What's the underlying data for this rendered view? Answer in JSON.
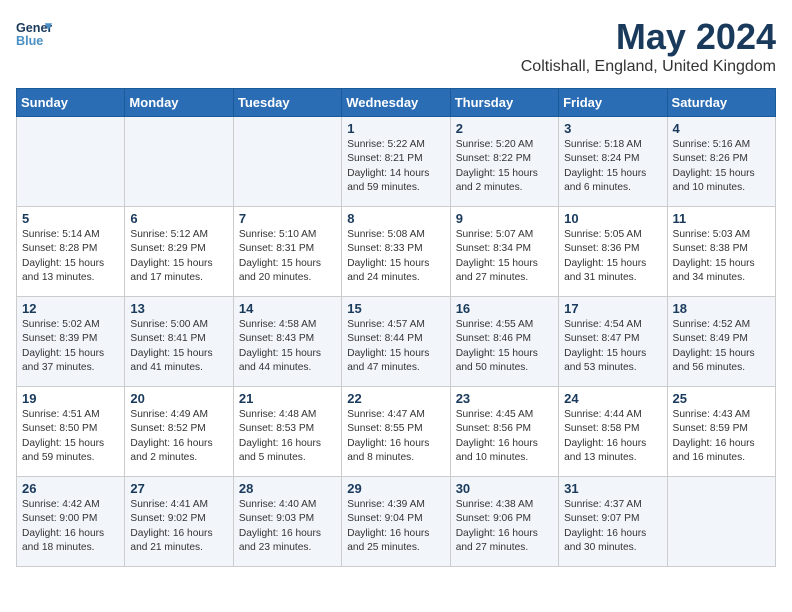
{
  "header": {
    "logo_line1": "General",
    "logo_line2": "Blue",
    "title": "May 2024",
    "subtitle": "Coltishall, England, United Kingdom"
  },
  "weekdays": [
    "Sunday",
    "Monday",
    "Tuesday",
    "Wednesday",
    "Thursday",
    "Friday",
    "Saturday"
  ],
  "weeks": [
    [
      {
        "day": "",
        "text": ""
      },
      {
        "day": "",
        "text": ""
      },
      {
        "day": "",
        "text": ""
      },
      {
        "day": "1",
        "text": "Sunrise: 5:22 AM\nSunset: 8:21 PM\nDaylight: 14 hours\nand 59 minutes."
      },
      {
        "day": "2",
        "text": "Sunrise: 5:20 AM\nSunset: 8:22 PM\nDaylight: 15 hours\nand 2 minutes."
      },
      {
        "day": "3",
        "text": "Sunrise: 5:18 AM\nSunset: 8:24 PM\nDaylight: 15 hours\nand 6 minutes."
      },
      {
        "day": "4",
        "text": "Sunrise: 5:16 AM\nSunset: 8:26 PM\nDaylight: 15 hours\nand 10 minutes."
      }
    ],
    [
      {
        "day": "5",
        "text": "Sunrise: 5:14 AM\nSunset: 8:28 PM\nDaylight: 15 hours\nand 13 minutes."
      },
      {
        "day": "6",
        "text": "Sunrise: 5:12 AM\nSunset: 8:29 PM\nDaylight: 15 hours\nand 17 minutes."
      },
      {
        "day": "7",
        "text": "Sunrise: 5:10 AM\nSunset: 8:31 PM\nDaylight: 15 hours\nand 20 minutes."
      },
      {
        "day": "8",
        "text": "Sunrise: 5:08 AM\nSunset: 8:33 PM\nDaylight: 15 hours\nand 24 minutes."
      },
      {
        "day": "9",
        "text": "Sunrise: 5:07 AM\nSunset: 8:34 PM\nDaylight: 15 hours\nand 27 minutes."
      },
      {
        "day": "10",
        "text": "Sunrise: 5:05 AM\nSunset: 8:36 PM\nDaylight: 15 hours\nand 31 minutes."
      },
      {
        "day": "11",
        "text": "Sunrise: 5:03 AM\nSunset: 8:38 PM\nDaylight: 15 hours\nand 34 minutes."
      }
    ],
    [
      {
        "day": "12",
        "text": "Sunrise: 5:02 AM\nSunset: 8:39 PM\nDaylight: 15 hours\nand 37 minutes."
      },
      {
        "day": "13",
        "text": "Sunrise: 5:00 AM\nSunset: 8:41 PM\nDaylight: 15 hours\nand 41 minutes."
      },
      {
        "day": "14",
        "text": "Sunrise: 4:58 AM\nSunset: 8:43 PM\nDaylight: 15 hours\nand 44 minutes."
      },
      {
        "day": "15",
        "text": "Sunrise: 4:57 AM\nSunset: 8:44 PM\nDaylight: 15 hours\nand 47 minutes."
      },
      {
        "day": "16",
        "text": "Sunrise: 4:55 AM\nSunset: 8:46 PM\nDaylight: 15 hours\nand 50 minutes."
      },
      {
        "day": "17",
        "text": "Sunrise: 4:54 AM\nSunset: 8:47 PM\nDaylight: 15 hours\nand 53 minutes."
      },
      {
        "day": "18",
        "text": "Sunrise: 4:52 AM\nSunset: 8:49 PM\nDaylight: 15 hours\nand 56 minutes."
      }
    ],
    [
      {
        "day": "19",
        "text": "Sunrise: 4:51 AM\nSunset: 8:50 PM\nDaylight: 15 hours\nand 59 minutes."
      },
      {
        "day": "20",
        "text": "Sunrise: 4:49 AM\nSunset: 8:52 PM\nDaylight: 16 hours\nand 2 minutes."
      },
      {
        "day": "21",
        "text": "Sunrise: 4:48 AM\nSunset: 8:53 PM\nDaylight: 16 hours\nand 5 minutes."
      },
      {
        "day": "22",
        "text": "Sunrise: 4:47 AM\nSunset: 8:55 PM\nDaylight: 16 hours\nand 8 minutes."
      },
      {
        "day": "23",
        "text": "Sunrise: 4:45 AM\nSunset: 8:56 PM\nDaylight: 16 hours\nand 10 minutes."
      },
      {
        "day": "24",
        "text": "Sunrise: 4:44 AM\nSunset: 8:58 PM\nDaylight: 16 hours\nand 13 minutes."
      },
      {
        "day": "25",
        "text": "Sunrise: 4:43 AM\nSunset: 8:59 PM\nDaylight: 16 hours\nand 16 minutes."
      }
    ],
    [
      {
        "day": "26",
        "text": "Sunrise: 4:42 AM\nSunset: 9:00 PM\nDaylight: 16 hours\nand 18 minutes."
      },
      {
        "day": "27",
        "text": "Sunrise: 4:41 AM\nSunset: 9:02 PM\nDaylight: 16 hours\nand 21 minutes."
      },
      {
        "day": "28",
        "text": "Sunrise: 4:40 AM\nSunset: 9:03 PM\nDaylight: 16 hours\nand 23 minutes."
      },
      {
        "day": "29",
        "text": "Sunrise: 4:39 AM\nSunset: 9:04 PM\nDaylight: 16 hours\nand 25 minutes."
      },
      {
        "day": "30",
        "text": "Sunrise: 4:38 AM\nSunset: 9:06 PM\nDaylight: 16 hours\nand 27 minutes."
      },
      {
        "day": "31",
        "text": "Sunrise: 4:37 AM\nSunset: 9:07 PM\nDaylight: 16 hours\nand 30 minutes."
      },
      {
        "day": "",
        "text": ""
      }
    ]
  ]
}
